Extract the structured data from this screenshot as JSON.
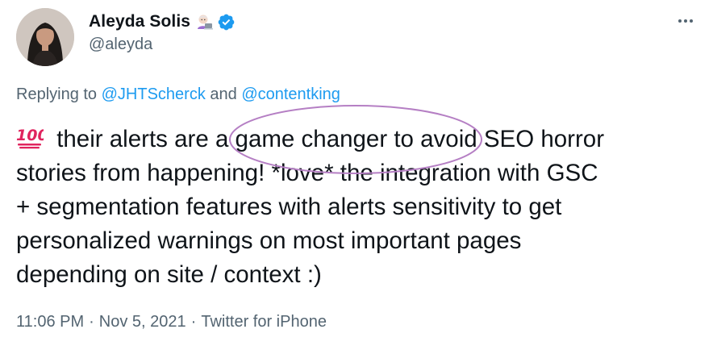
{
  "author": {
    "display_name": "Aleyda Solis",
    "handle": "@aleyda",
    "name_emoji": "woman-technologist-emoji",
    "verified_icon": "verified-badge-icon"
  },
  "replying": {
    "prefix": "Replying to ",
    "mention_1": "@JHTScherck",
    "joiner": " and ",
    "mention_2": "@contentking"
  },
  "tweet": {
    "leading_emoji": "hundred-points-emoji",
    "text": " their alerts are a game changer to avoid SEO horror\nstories from happening! *love* the integration with GSC\n+ segmentation features with alerts sensitivity to get\npersonalized warnings on most important pages\ndepending on site / context :)"
  },
  "meta": {
    "time": "11:06 PM",
    "separator": "·",
    "date": "Nov 5, 2021",
    "source": "Twitter for iPhone"
  },
  "colors": {
    "text": "#0f1419",
    "secondary": "#536471",
    "link": "#1d9bf0",
    "annotation": "#b57fc4"
  }
}
